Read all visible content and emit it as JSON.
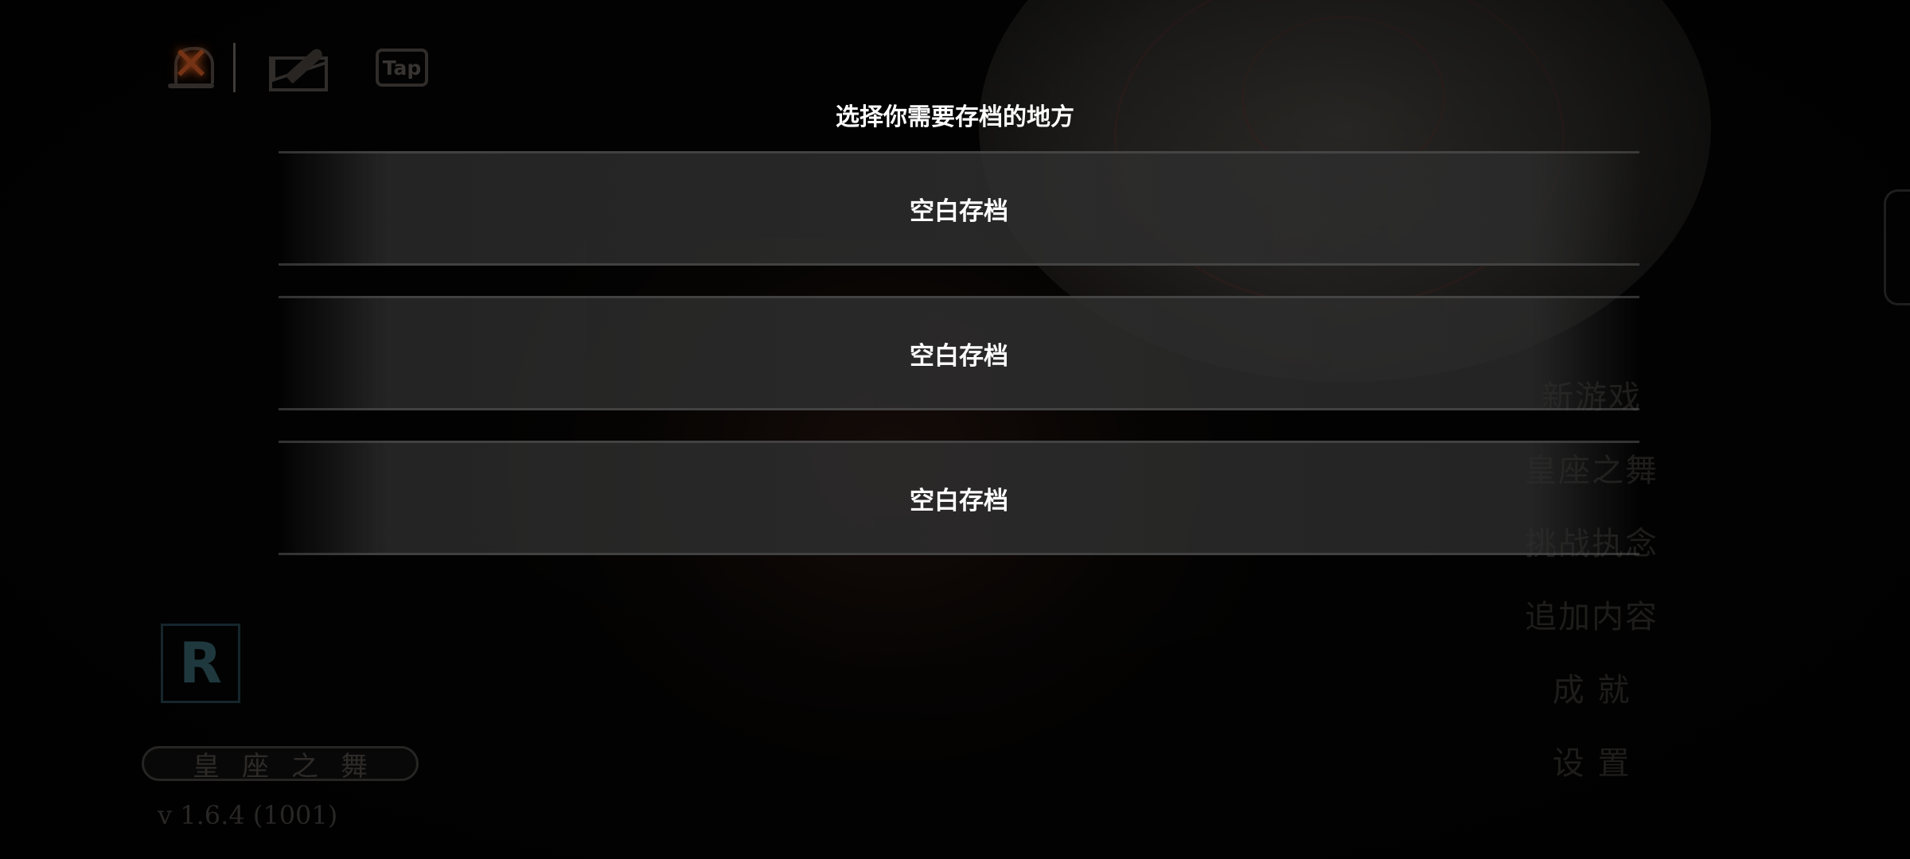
{
  "top_icons": {
    "tap_label": "Tap",
    "bell_mark": "✕"
  },
  "main_menu": {
    "items": [
      "新游戏",
      "皇座之舞",
      "挑战执念",
      "追加内容",
      "成 就",
      "设 置"
    ]
  },
  "game_title": "皇座之舞",
  "version": "v 1.6.4 (1001)",
  "logo_letter": "R",
  "save_dialog": {
    "title": "选择你需要存档的地方",
    "slots": [
      {
        "label": "空白存档"
      },
      {
        "label": "空白存档"
      },
      {
        "label": "空白存档"
      }
    ]
  },
  "colors": {
    "accent_glow": "#e0602a",
    "overlay": "#000000"
  }
}
